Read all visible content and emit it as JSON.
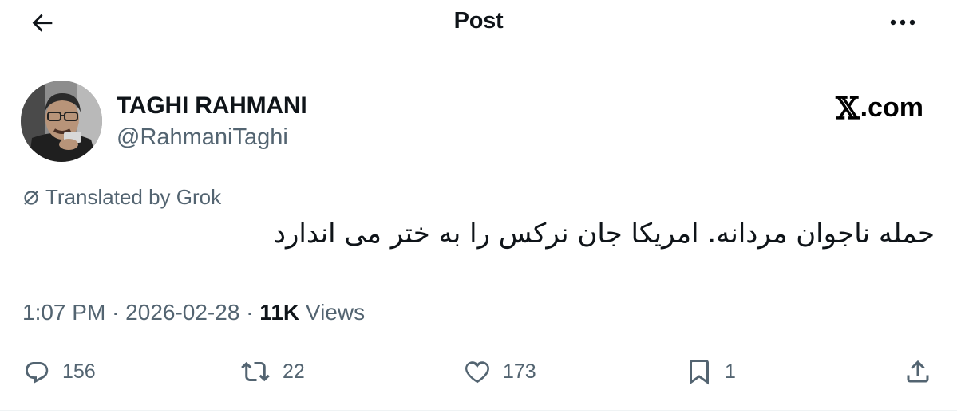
{
  "header": {
    "back_icon": "arrow-left-icon",
    "title": "Post",
    "more_icon": "more-horizontal-icon"
  },
  "author": {
    "display_name": "TAGHI RAHMANI",
    "handle": "@RahmaniTaghi",
    "avatar_icon": "user-avatar-photo"
  },
  "brand": {
    "x_glyph": "𝕏",
    "suffix": ".com"
  },
  "translation": {
    "icon": "translate-slash-icon",
    "label": "Translated by Grok"
  },
  "tweet": {
    "text": "حمله ناجوان مردانه. امریکا جان نرکس را به ختر می اندارد"
  },
  "meta": {
    "time": "1:07 PM",
    "separator1": " · ",
    "date": "2026-02-28",
    "separator2": " · ",
    "views_count": "11K",
    "views_label": " Views"
  },
  "actions": {
    "reply": {
      "icon": "reply-icon",
      "count": "156"
    },
    "repost": {
      "icon": "repost-icon",
      "count": "22"
    },
    "like": {
      "icon": "heart-icon",
      "count": "173"
    },
    "bookmark": {
      "icon": "bookmark-icon",
      "count": "1"
    },
    "share": {
      "icon": "share-icon"
    }
  },
  "colors": {
    "text_primary": "#0f1419",
    "text_secondary": "#536471",
    "background": "#ffffff"
  }
}
